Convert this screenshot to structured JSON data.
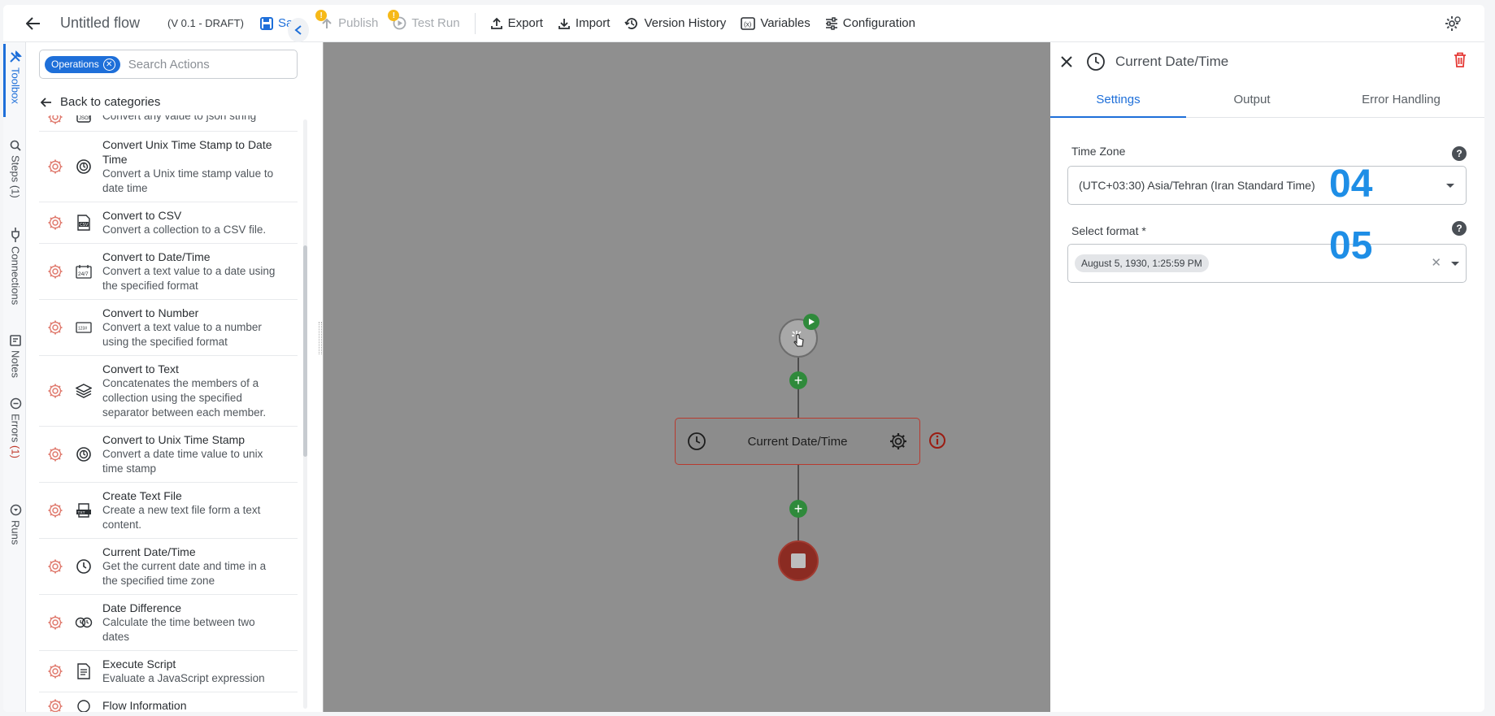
{
  "toolbar": {
    "flow_title": "Untitled flow",
    "version": "(V 0.1 - DRAFT)",
    "save": "Save",
    "publish": "Publish",
    "test_run": "Test Run",
    "export": "Export",
    "import": "Import",
    "version_history": "Version History",
    "variables": "Variables",
    "configuration": "Configuration",
    "publish_warning": "!",
    "test_warning": "!"
  },
  "rail": {
    "toolbox": "Toolbox",
    "steps": "Steps",
    "steps_count": "(1)",
    "connections": "Connections",
    "notes": "Notes",
    "errors": "Errors",
    "errors_count": "(1)",
    "runs": "Runs"
  },
  "toolbox": {
    "chip": "Operations",
    "search_placeholder": "Search Actions",
    "back": "Back to categories",
    "items": [
      {
        "title": "",
        "desc": "Convert any value to json string",
        "icon": "json-icon"
      },
      {
        "title": "Convert Unix Time Stamp to Date Time",
        "desc": "Convert a Unix time stamp value to date time",
        "icon": "timestamp-icon"
      },
      {
        "title": "Convert to CSV",
        "desc": "Convert a collection to a CSV file.",
        "icon": "csv-icon"
      },
      {
        "title": "Convert to Date/Time",
        "desc": "Convert a text value to a date using the specified format",
        "icon": "calendar-24-7-icon"
      },
      {
        "title": "Convert to Number",
        "desc": "Convert a text value to a number using the specified format",
        "icon": "number-icon"
      },
      {
        "title": "Convert to Text",
        "desc": "Concatenates the members of a collection using the specified separator between each member.",
        "icon": "layers-icon"
      },
      {
        "title": "Convert to Unix Time Stamp",
        "desc": "Convert a date time value to unix time stamp",
        "icon": "timestamp-icon"
      },
      {
        "title": "Create Text File",
        "desc": "Create a new text file form a text content.",
        "icon": "text-file-icon"
      },
      {
        "title": "Current Date/Time",
        "desc": "Get the current date and time in a the specified time zone",
        "icon": "clock-icon"
      },
      {
        "title": "Date Difference",
        "desc": "Calculate the time between two dates",
        "icon": "date-diff-icon"
      },
      {
        "title": "Execute Script",
        "desc": "Evaluate a JavaScript expression",
        "icon": "script-icon"
      },
      {
        "title": "Flow Information",
        "desc": "",
        "icon": "info-icon"
      }
    ]
  },
  "canvas": {
    "step_label": "Current Date/Time"
  },
  "panel": {
    "title": "Current Date/Time",
    "tabs": [
      "Settings",
      "Output",
      "Error Handling"
    ],
    "timezone_label": "Time Zone",
    "timezone_value": "(UTC+03:30) Asia/Tehran (Iran Standard Time)",
    "timezone_number": "04",
    "format_label": "Select format *",
    "format_value": "August 5, 1930, 1:25:59 PM",
    "format_number": "05"
  },
  "colors": {
    "accent": "#1e6fd9",
    "number_overlay": "#1e8ee6",
    "error": "#b83a2f",
    "success": "#2f8a3b",
    "canvas": "#8f8f8f"
  }
}
